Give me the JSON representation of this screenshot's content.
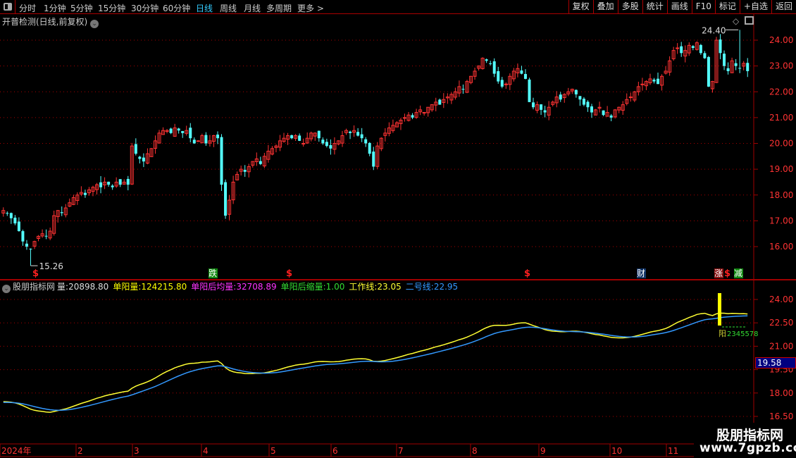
{
  "toolbar": {
    "periods": [
      "分时",
      "1分钟",
      "5分钟",
      "15分钟",
      "30分钟",
      "60分钟",
      "日线",
      "周线",
      "月线",
      "多周期",
      "更多 >"
    ],
    "active_period": "日线",
    "right_buttons": [
      "复权",
      "叠加",
      "多股",
      "统计",
      "画线",
      "F10",
      "标记",
      "+自选",
      "返回"
    ]
  },
  "main_chart": {
    "title": "开普检测(日线,前复权)",
    "y_ticks": [
      "24.00",
      "23.00",
      "22.00",
      "21.00",
      "20.00",
      "19.00",
      "18.00",
      "17.00",
      "16.00"
    ],
    "high_label": "24.40",
    "low_label": "15.26",
    "markers": [
      {
        "text": "$",
        "kind": "dollar"
      },
      {
        "text": "跌",
        "kind": "green"
      },
      {
        "text": "$",
        "kind": "dollar"
      },
      {
        "text": "$",
        "kind": "dollar"
      },
      {
        "text": "财",
        "kind": "blue"
      },
      {
        "text": "涨",
        "kind": "red"
      },
      {
        "text": "$",
        "kind": "dollar"
      },
      {
        "text": "减",
        "kind": "green"
      }
    ],
    "closes": [
      17.4,
      17.3,
      17.1,
      16.9,
      16.6,
      16.2,
      16.0,
      15.9,
      16.2,
      16.4,
      16.5,
      16.4,
      16.6,
      17.2,
      17.4,
      17.3,
      17.5,
      17.7,
      17.9,
      18.0,
      18.1,
      18.0,
      18.2,
      18.3,
      18.4,
      18.3,
      18.5,
      18.4,
      18.3,
      18.5,
      18.4,
      18.5,
      18.4,
      19.9,
      19.6,
      19.4,
      19.3,
      19.6,
      19.8,
      20.1,
      20.4,
      20.5,
      20.5,
      20.4,
      20.6,
      20.5,
      20.4,
      20.5,
      20.2,
      20.0,
      20.1,
      20.3,
      20.0,
      20.1,
      20.3,
      20.2,
      18.4,
      17.2,
      17.8,
      18.5,
      18.8,
      19.0,
      18.9,
      19.1,
      19.3,
      19.4,
      19.2,
      19.5,
      19.7,
      19.8,
      19.9,
      20.1,
      20.2,
      20.3,
      20.2,
      20.3,
      20.1,
      20.0,
      20.2,
      20.4,
      20.4,
      20.2,
      20.0,
      19.9,
      19.8,
      20.0,
      20.1,
      20.3,
      20.5,
      20.4,
      20.5,
      20.3,
      20.2,
      20.0,
      19.6,
      19.1,
      19.9,
      20.2,
      20.4,
      20.6,
      20.7,
      20.8,
      20.9,
      21.0,
      21.1,
      21.0,
      21.2,
      21.3,
      21.2,
      21.4,
      21.5,
      21.6,
      21.5,
      21.7,
      21.8,
      21.9,
      22.0,
      22.2,
      22.1,
      22.4,
      22.6,
      22.8,
      23.0,
      23.3,
      23.2,
      23.1,
      22.7,
      22.4,
      22.2,
      22.3,
      22.6,
      22.8,
      22.9,
      22.7,
      22.5,
      21.6,
      21.4,
      21.5,
      21.3,
      21.2,
      21.4,
      21.6,
      21.8,
      21.7,
      21.9,
      22.0,
      22.1,
      21.9,
      21.7,
      21.5,
      21.4,
      21.2,
      21.3,
      21.4,
      21.1,
      21.2,
      21.0,
      21.3,
      21.4,
      21.5,
      21.7,
      21.8,
      22.0,
      22.2,
      22.3,
      22.4,
      22.5,
      22.4,
      22.3,
      22.6,
      22.8,
      23.2,
      23.6,
      23.7,
      23.5,
      23.6,
      23.8,
      23.7,
      23.9,
      23.5,
      23.3,
      22.2,
      22.4,
      24.0,
      23.5,
      23.0,
      22.8,
      23.2,
      23.0,
      22.9,
      23.1,
      22.8
    ],
    "high_index": 189,
    "low_index": 7
  },
  "indicator": {
    "name": "股朋指标网",
    "legend": [
      {
        "label": "量:",
        "value": "20898.80",
        "color": "#dddddd"
      },
      {
        "label": "单阳量:",
        "value": "124215.80",
        "color": "#ffff00"
      },
      {
        "label": "单阳后均量:",
        "value": "32708.89",
        "color": "#ff33ff"
      },
      {
        "label": "单阳后缩量:",
        "value": "1.00",
        "color": "#33dd33"
      },
      {
        "label": "工作线:",
        "value": "23.05",
        "color": "#ffff33"
      },
      {
        "label": "二号线:",
        "value": "22.95",
        "color": "#3399ff"
      }
    ],
    "y_ticks": [
      "24.00",
      "22.50",
      "21.00",
      "19.50",
      "18.00",
      "16.50"
    ],
    "current_value": "19.58",
    "signal_prefix": "阳",
    "signal_digits": "2345578",
    "colors": {
      "work_line": "#ffff33",
      "line2": "#3399ff"
    }
  },
  "x_axis": {
    "labels": [
      "2024年",
      "2",
      "3",
      "4",
      "5",
      "6",
      "7",
      "8",
      "9",
      "10",
      "11"
    ]
  },
  "watermark": {
    "line1": "股朋指标网",
    "line2": "www.7gpzb.com"
  },
  "colors": {
    "up": "#ff3333",
    "down": "#54ffff",
    "grid": "#a00000",
    "axis_text": "#ff3333"
  }
}
